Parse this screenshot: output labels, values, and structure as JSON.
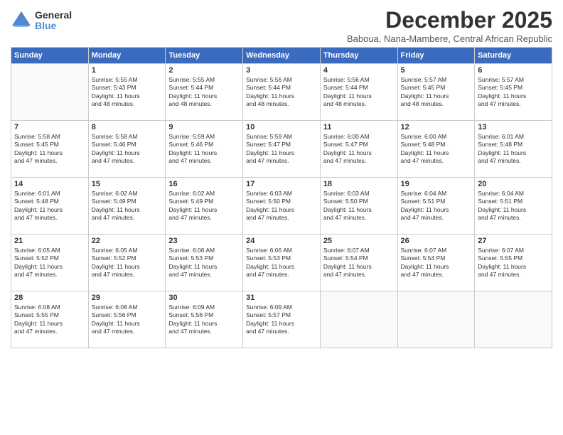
{
  "logo": {
    "general": "General",
    "blue": "Blue"
  },
  "title": "December 2025",
  "subtitle": "Baboua, Nana-Mambere, Central African Republic",
  "headers": [
    "Sunday",
    "Monday",
    "Tuesday",
    "Wednesday",
    "Thursday",
    "Friday",
    "Saturday"
  ],
  "weeks": [
    [
      {
        "day": "",
        "info": ""
      },
      {
        "day": "1",
        "info": "Sunrise: 5:55 AM\nSunset: 5:43 PM\nDaylight: 11 hours\nand 48 minutes."
      },
      {
        "day": "2",
        "info": "Sunrise: 5:55 AM\nSunset: 5:44 PM\nDaylight: 11 hours\nand 48 minutes."
      },
      {
        "day": "3",
        "info": "Sunrise: 5:56 AM\nSunset: 5:44 PM\nDaylight: 11 hours\nand 48 minutes."
      },
      {
        "day": "4",
        "info": "Sunrise: 5:56 AM\nSunset: 5:44 PM\nDaylight: 11 hours\nand 48 minutes."
      },
      {
        "day": "5",
        "info": "Sunrise: 5:57 AM\nSunset: 5:45 PM\nDaylight: 11 hours\nand 48 minutes."
      },
      {
        "day": "6",
        "info": "Sunrise: 5:57 AM\nSunset: 5:45 PM\nDaylight: 11 hours\nand 47 minutes."
      }
    ],
    [
      {
        "day": "7",
        "info": "Sunrise: 5:58 AM\nSunset: 5:45 PM\nDaylight: 11 hours\nand 47 minutes."
      },
      {
        "day": "8",
        "info": "Sunrise: 5:58 AM\nSunset: 5:46 PM\nDaylight: 11 hours\nand 47 minutes."
      },
      {
        "day": "9",
        "info": "Sunrise: 5:59 AM\nSunset: 5:46 PM\nDaylight: 11 hours\nand 47 minutes."
      },
      {
        "day": "10",
        "info": "Sunrise: 5:59 AM\nSunset: 5:47 PM\nDaylight: 11 hours\nand 47 minutes."
      },
      {
        "day": "11",
        "info": "Sunrise: 6:00 AM\nSunset: 5:47 PM\nDaylight: 11 hours\nand 47 minutes."
      },
      {
        "day": "12",
        "info": "Sunrise: 6:00 AM\nSunset: 5:48 PM\nDaylight: 11 hours\nand 47 minutes."
      },
      {
        "day": "13",
        "info": "Sunrise: 6:01 AM\nSunset: 5:48 PM\nDaylight: 11 hours\nand 47 minutes."
      }
    ],
    [
      {
        "day": "14",
        "info": "Sunrise: 6:01 AM\nSunset: 5:48 PM\nDaylight: 11 hours\nand 47 minutes."
      },
      {
        "day": "15",
        "info": "Sunrise: 6:02 AM\nSunset: 5:49 PM\nDaylight: 11 hours\nand 47 minutes."
      },
      {
        "day": "16",
        "info": "Sunrise: 6:02 AM\nSunset: 5:49 PM\nDaylight: 11 hours\nand 47 minutes."
      },
      {
        "day": "17",
        "info": "Sunrise: 6:03 AM\nSunset: 5:50 PM\nDaylight: 11 hours\nand 47 minutes."
      },
      {
        "day": "18",
        "info": "Sunrise: 6:03 AM\nSunset: 5:50 PM\nDaylight: 11 hours\nand 47 minutes."
      },
      {
        "day": "19",
        "info": "Sunrise: 6:04 AM\nSunset: 5:51 PM\nDaylight: 11 hours\nand 47 minutes."
      },
      {
        "day": "20",
        "info": "Sunrise: 6:04 AM\nSunset: 5:51 PM\nDaylight: 11 hours\nand 47 minutes."
      }
    ],
    [
      {
        "day": "21",
        "info": "Sunrise: 6:05 AM\nSunset: 5:52 PM\nDaylight: 11 hours\nand 47 minutes."
      },
      {
        "day": "22",
        "info": "Sunrise: 6:05 AM\nSunset: 5:52 PM\nDaylight: 11 hours\nand 47 minutes."
      },
      {
        "day": "23",
        "info": "Sunrise: 6:06 AM\nSunset: 5:53 PM\nDaylight: 11 hours\nand 47 minutes."
      },
      {
        "day": "24",
        "info": "Sunrise: 6:06 AM\nSunset: 5:53 PM\nDaylight: 11 hours\nand 47 minutes."
      },
      {
        "day": "25",
        "info": "Sunrise: 6:07 AM\nSunset: 5:54 PM\nDaylight: 11 hours\nand 47 minutes."
      },
      {
        "day": "26",
        "info": "Sunrise: 6:07 AM\nSunset: 5:54 PM\nDaylight: 11 hours\nand 47 minutes."
      },
      {
        "day": "27",
        "info": "Sunrise: 6:07 AM\nSunset: 5:55 PM\nDaylight: 11 hours\nand 47 minutes."
      }
    ],
    [
      {
        "day": "28",
        "info": "Sunrise: 6:08 AM\nSunset: 5:55 PM\nDaylight: 11 hours\nand 47 minutes."
      },
      {
        "day": "29",
        "info": "Sunrise: 6:08 AM\nSunset: 5:56 PM\nDaylight: 11 hours\nand 47 minutes."
      },
      {
        "day": "30",
        "info": "Sunrise: 6:09 AM\nSunset: 5:56 PM\nDaylight: 11 hours\nand 47 minutes."
      },
      {
        "day": "31",
        "info": "Sunrise: 6:09 AM\nSunset: 5:57 PM\nDaylight: 11 hours\nand 47 minutes."
      },
      {
        "day": "",
        "info": ""
      },
      {
        "day": "",
        "info": ""
      },
      {
        "day": "",
        "info": ""
      }
    ]
  ]
}
